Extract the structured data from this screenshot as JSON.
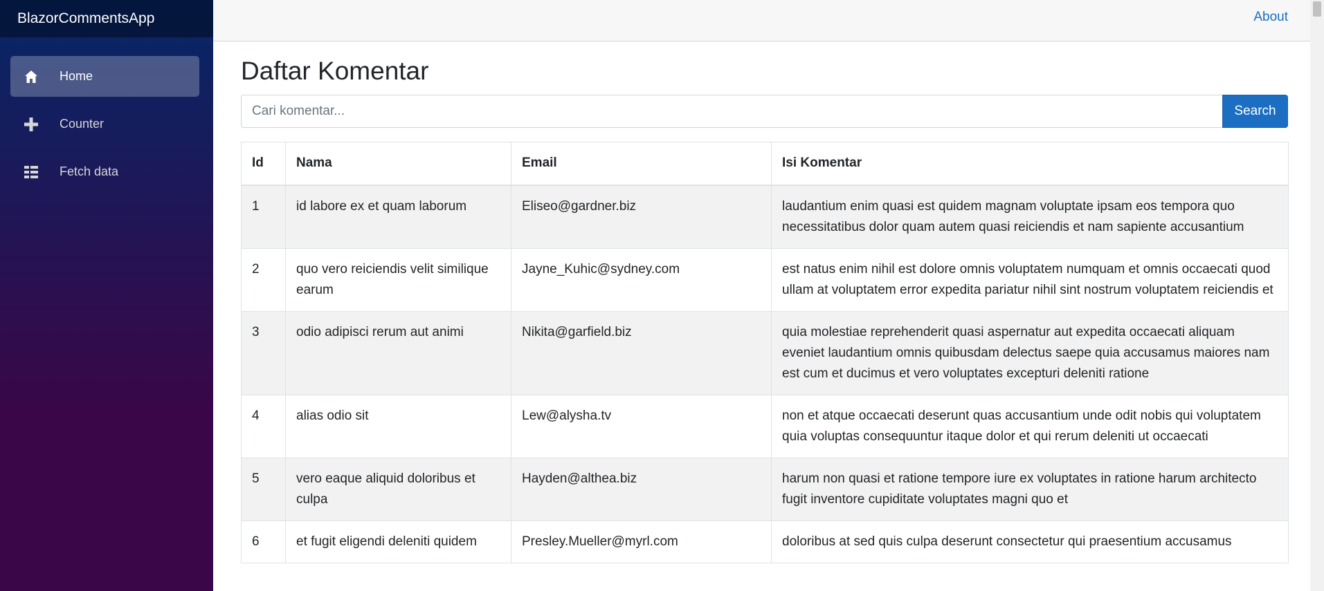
{
  "app": {
    "brand": "BlazorCommentsApp"
  },
  "nav": {
    "items": [
      {
        "label": "Home",
        "icon": "home-icon"
      },
      {
        "label": "Counter",
        "icon": "plus-icon"
      },
      {
        "label": "Fetch data",
        "icon": "list-icon"
      }
    ]
  },
  "header": {
    "about_label": "About"
  },
  "page": {
    "title": "Daftar Komentar"
  },
  "search": {
    "placeholder": "Cari komentar...",
    "value": "",
    "button_label": "Search"
  },
  "table": {
    "columns": [
      "Id",
      "Nama",
      "Email",
      "Isi Komentar"
    ],
    "rows": [
      {
        "id": "1",
        "name": "id labore ex et quam laborum",
        "email": "Eliseo@gardner.biz",
        "body": "laudantium enim quasi est quidem magnam voluptate ipsam eos tempora quo necessitatibus dolor quam autem quasi reiciendis et nam sapiente accusantium"
      },
      {
        "id": "2",
        "name": "quo vero reiciendis velit similique earum",
        "email": "Jayne_Kuhic@sydney.com",
        "body": "est natus enim nihil est dolore omnis voluptatem numquam et omnis occaecati quod ullam at voluptatem error expedita pariatur nihil sint nostrum voluptatem reiciendis et"
      },
      {
        "id": "3",
        "name": "odio adipisci rerum aut animi",
        "email": "Nikita@garfield.biz",
        "body": "quia molestiae reprehenderit quasi aspernatur aut expedita occaecati aliquam eveniet laudantium omnis quibusdam delectus saepe quia accusamus maiores nam est cum et ducimus et vero voluptates excepturi deleniti ratione"
      },
      {
        "id": "4",
        "name": "alias odio sit",
        "email": "Lew@alysha.tv",
        "body": "non et atque occaecati deserunt quas accusantium unde odit nobis qui voluptatem quia voluptas consequuntur itaque dolor et qui rerum deleniti ut occaecati"
      },
      {
        "id": "5",
        "name": "vero eaque aliquid doloribus et culpa",
        "email": "Hayden@althea.biz",
        "body": "harum non quasi et ratione tempore iure ex voluptates in ratione harum architecto fugit inventore cupiditate voluptates magni quo et"
      },
      {
        "id": "6",
        "name": "et fugit eligendi deleniti quidem",
        "email": "Presley.Mueller@myrl.com",
        "body": "doloribus at sed quis culpa deserunt consectetur qui praesentium accusamus"
      }
    ]
  }
}
